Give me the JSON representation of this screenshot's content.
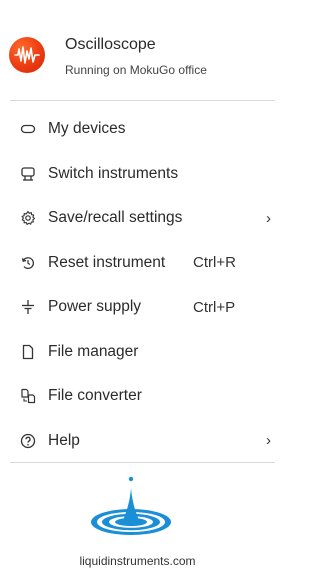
{
  "header": {
    "app_icon": "waveform-icon",
    "title": "Oscilloscope",
    "subtitle": "Running on MokuGo office"
  },
  "menu": {
    "items": [
      {
        "label": "My devices",
        "icon": "device-icon",
        "shortcut": "",
        "submenu": false
      },
      {
        "label": "Switch instruments",
        "icon": "switch-instrument-icon",
        "shortcut": "",
        "submenu": false
      },
      {
        "label": "Save/recall settings",
        "icon": "gear-icon",
        "shortcut": "",
        "submenu": true
      },
      {
        "label": "Reset instrument",
        "icon": "reset-icon",
        "shortcut": "Ctrl+R",
        "submenu": false
      },
      {
        "label": "Power supply",
        "icon": "power-supply-icon",
        "shortcut": "Ctrl+P",
        "submenu": false
      },
      {
        "label": "File manager",
        "icon": "file-icon",
        "shortcut": "",
        "submenu": false
      },
      {
        "label": "File converter",
        "icon": "file-convert-icon",
        "shortcut": "",
        "submenu": false
      },
      {
        "label": "Help",
        "icon": "help-icon",
        "shortcut": "",
        "submenu": true
      }
    ],
    "chevron": "›"
  },
  "footer": {
    "logo": "liquid-instruments-drop-logo",
    "link": "liquidinstruments.com"
  },
  "colors": {
    "brand_orange": "#ec3b12",
    "brand_blue": "#1a8fd6",
    "divider": "#d9d9d9"
  }
}
